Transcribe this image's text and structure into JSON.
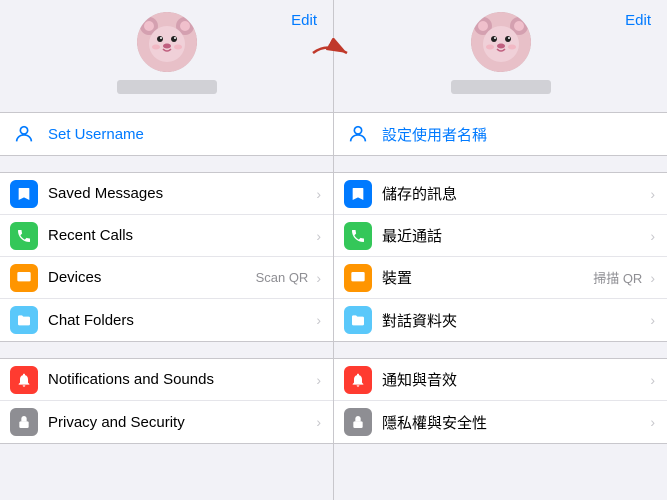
{
  "left": {
    "edit_label": "Edit",
    "username_icon": "person",
    "set_username_label": "Set Username",
    "items_group1": [
      {
        "id": "saved",
        "icon": "bookmark",
        "icon_color": "icon-blue",
        "label": "Saved Messages",
        "sub": "",
        "chevron": "›"
      },
      {
        "id": "calls",
        "icon": "phone",
        "icon_color": "icon-green",
        "label": "Recent Calls",
        "sub": "",
        "chevron": "›"
      },
      {
        "id": "devices",
        "icon": "desktop",
        "icon_color": "icon-orange",
        "label": "Devices",
        "sub": "Scan QR",
        "chevron": "›"
      },
      {
        "id": "folders",
        "icon": "folder",
        "icon_color": "icon-teal",
        "label": "Chat Folders",
        "sub": "",
        "chevron": "›"
      }
    ],
    "items_group2": [
      {
        "id": "notif",
        "icon": "bell",
        "icon_color": "icon-red",
        "label": "Notifications and Sounds",
        "sub": "",
        "chevron": "›"
      },
      {
        "id": "privacy",
        "icon": "lock",
        "icon_color": "icon-gray",
        "label": "Privacy and Security",
        "sub": "",
        "chevron": "›"
      }
    ]
  },
  "right": {
    "edit_label": "Edit",
    "username_icon": "person",
    "set_username_label": "設定使用者名稱",
    "items_group1": [
      {
        "id": "saved",
        "icon": "bookmark",
        "icon_color": "icon-blue",
        "label": "儲存的訊息",
        "sub": "",
        "chevron": "›"
      },
      {
        "id": "calls",
        "icon": "phone",
        "icon_color": "icon-green",
        "label": "最近通話",
        "sub": "",
        "chevron": "›"
      },
      {
        "id": "devices",
        "icon": "desktop",
        "icon_color": "icon-orange",
        "label": "裝置",
        "sub": "掃描 QR",
        "chevron": "›"
      },
      {
        "id": "folders",
        "icon": "folder",
        "icon_color": "icon-teal",
        "label": "對話資料夾",
        "sub": "",
        "chevron": "›"
      }
    ],
    "items_group2": [
      {
        "id": "notif",
        "icon": "bell",
        "icon_color": "icon-red",
        "label": "通知與音效",
        "sub": "",
        "chevron": "›"
      },
      {
        "id": "privacy",
        "icon": "lock",
        "icon_color": "icon-gray",
        "label": "隱私權與安全性",
        "sub": "",
        "chevron": "›"
      }
    ]
  },
  "arrow": "→"
}
